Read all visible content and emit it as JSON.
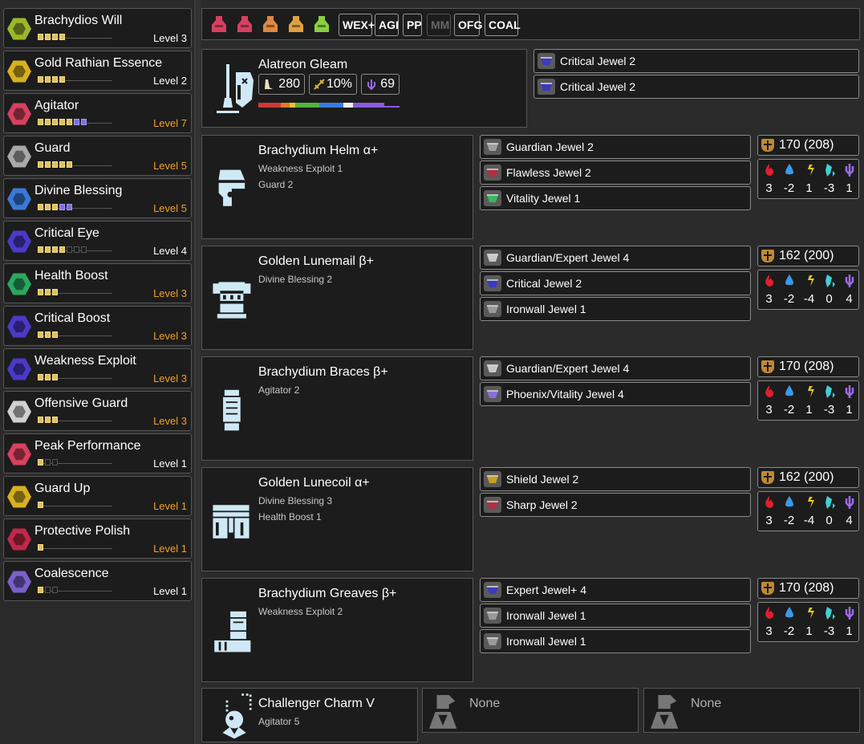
{
  "skills": [
    {
      "name": "Brachydios Will",
      "level": "Level 3",
      "color": "#9ab82a",
      "max": false,
      "pips": [
        "on",
        "on",
        "on",
        "on"
      ]
    },
    {
      "name": "Gold Rathian Essence",
      "level": "Level 2",
      "color": "#d8b020",
      "max": false,
      "pips": [
        "on",
        "on",
        "on",
        "on"
      ]
    },
    {
      "name": "Agitator",
      "level": "Level 7",
      "color": "#d84060",
      "max": true,
      "pips": [
        "on",
        "on",
        "on",
        "on",
        "on",
        "deco",
        "deco"
      ]
    },
    {
      "name": "Guard",
      "level": "Level 5",
      "color": "#a8a8a8",
      "max": true,
      "pips": [
        "on",
        "on",
        "on",
        "on",
        "on"
      ]
    },
    {
      "name": "Divine Blessing",
      "level": "Level 5",
      "color": "#3a78d8",
      "max": true,
      "pips": [
        "on",
        "on",
        "on",
        "deco",
        "deco"
      ]
    },
    {
      "name": "Critical Eye",
      "level": "Level 4",
      "color": "#4a3ac8",
      "max": false,
      "pips": [
        "on",
        "on",
        "on",
        "on",
        "off",
        "off",
        "off"
      ]
    },
    {
      "name": "Health Boost",
      "level": "Level 3",
      "color": "#2aa860",
      "max": true,
      "pips": [
        "on",
        "on",
        "on"
      ]
    },
    {
      "name": "Critical Boost",
      "level": "Level 3",
      "color": "#4a3ac8",
      "max": true,
      "pips": [
        "on",
        "on",
        "on"
      ]
    },
    {
      "name": "Weakness Exploit",
      "level": "Level 3",
      "color": "#4a3ac8",
      "max": true,
      "pips": [
        "on",
        "on",
        "on"
      ]
    },
    {
      "name": "Offensive Guard",
      "level": "Level 3",
      "color": "#d0d0d0",
      "max": true,
      "pips": [
        "on",
        "on",
        "on"
      ]
    },
    {
      "name": "Peak Performance",
      "level": "Level 1",
      "color": "#d84060",
      "max": false,
      "pips": [
        "on",
        "off",
        "off"
      ]
    },
    {
      "name": "Guard Up",
      "level": "Level 1",
      "color": "#d8b020",
      "max": true,
      "pips": [
        "on"
      ]
    },
    {
      "name": "Protective Polish",
      "level": "Level 1",
      "color": "#c02848",
      "max": true,
      "pips": [
        "on"
      ]
    },
    {
      "name": "Coalescence",
      "level": "Level 1",
      "color": "#7a60c8",
      "max": false,
      "pips": [
        "on",
        "off",
        "off"
      ]
    }
  ],
  "topbar": {
    "icons": [
      {
        "name": "might-seed-icon",
        "color": "#d84060"
      },
      {
        "name": "demondrug-icon",
        "color": "#d84060"
      },
      {
        "name": "armorskin-icon",
        "color": "#e08840"
      },
      {
        "name": "dash-juice-icon",
        "color": "#e0a040"
      },
      {
        "name": "herbal-powder-icon",
        "color": "#8ad040"
      }
    ],
    "tags": [
      {
        "label": "WEX+",
        "active": true
      },
      {
        "label": "AGI",
        "active": true
      },
      {
        "label": "PP",
        "active": true
      },
      {
        "label": "MM",
        "active": false
      },
      {
        "label": "OFG",
        "active": true
      },
      {
        "label": "COAL",
        "active": true
      }
    ]
  },
  "weapon": {
    "name": "Alatreon Gleam",
    "attack": "280",
    "affinity": "10%",
    "element": "69",
    "decorations": [
      "Critical Jewel 2",
      "Critical Jewel 2"
    ],
    "sharpness": [
      {
        "color": "#d03838",
        "w": 0.16
      },
      {
        "color": "#e07828",
        "w": 0.06
      },
      {
        "color": "#e8c030",
        "w": 0.04
      },
      {
        "color": "#58b040",
        "w": 0.17
      },
      {
        "color": "#3a7ae0",
        "w": 0.17
      },
      {
        "color": "#f0f0f0",
        "w": 0.07
      },
      {
        "color": "#8a5ae0",
        "w": 0.22
      },
      {
        "color": "#8a5ae0",
        "w": 0.11
      }
    ]
  },
  "armor": [
    {
      "name": "Brachydium Helm α+",
      "skills": [
        "Weakness Exploit 1",
        "Guard 2"
      ],
      "decorations": [
        {
          "name": "Guardian Jewel 2",
          "color": "#a0a0a0"
        },
        {
          "name": "Flawless Jewel 2",
          "color": "#b03040"
        },
        {
          "name": "Vitality Jewel 1",
          "color": "#3ab860"
        }
      ],
      "defense": "170  (208)",
      "res": [
        "3",
        "-2",
        "1",
        "-3",
        "1"
      ]
    },
    {
      "name": "Golden Lunemail β+",
      "skills": [
        "Divine Blessing 2"
      ],
      "decorations": [
        {
          "name": "Guardian/Expert Jewel 4",
          "color": "#c8c8c8"
        },
        {
          "name": "Critical Jewel 2",
          "color": "#3a3ac0"
        },
        {
          "name": "Ironwall Jewel 1",
          "color": "#9a9a9a"
        }
      ],
      "defense": "162  (200)",
      "res": [
        "3",
        "-2",
        "-4",
        "0",
        "4"
      ]
    },
    {
      "name": "Brachydium Braces β+",
      "skills": [
        "Agitator 2"
      ],
      "decorations": [
        {
          "name": "Guardian/Expert Jewel 4",
          "color": "#c8c8c8"
        },
        {
          "name": "Phoenix/Vitality Jewel 4",
          "color": "#8a70d8"
        }
      ],
      "defense": "170  (208)",
      "res": [
        "3",
        "-2",
        "1",
        "-3",
        "1"
      ]
    },
    {
      "name": "Golden Lunecoil α+",
      "skills": [
        "Divine Blessing 3",
        "Health Boost 1"
      ],
      "decorations": [
        {
          "name": "Shield Jewel 2",
          "color": "#c8a020"
        },
        {
          "name": "Sharp Jewel 2",
          "color": "#b03040"
        }
      ],
      "defense": "162  (200)",
      "res": [
        "3",
        "-2",
        "-4",
        "0",
        "4"
      ]
    },
    {
      "name": "Brachydium Greaves β+",
      "skills": [
        "Weakness Exploit 2"
      ],
      "decorations": [
        {
          "name": "Expert Jewel+ 4",
          "color": "#3a3ac0"
        },
        {
          "name": "Ironwall Jewel 1",
          "color": "#9a9a9a"
        },
        {
          "name": "Ironwall Jewel 1",
          "color": "#9a9a9a"
        }
      ],
      "defense": "170  (208)",
      "res": [
        "3",
        "-2",
        "1",
        "-3",
        "1"
      ]
    }
  ],
  "charm": {
    "name": "Challenger Charm V",
    "skill": "Agitator 5"
  },
  "tools": [
    "None",
    "None"
  ]
}
